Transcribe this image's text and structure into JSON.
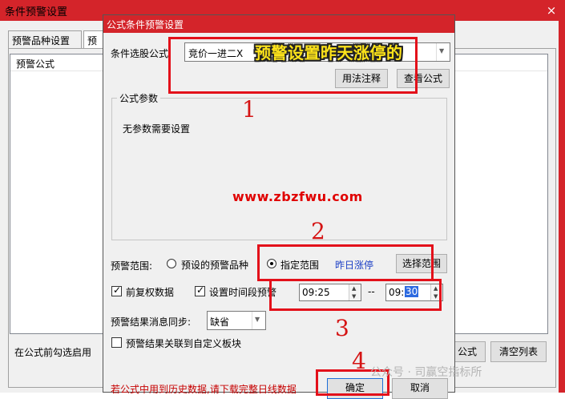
{
  "outer": {
    "title": "条件预警设置",
    "close_glyph": "×",
    "tabs": [
      "预警品种设置",
      "预"
    ],
    "list_header": "预警公式",
    "bottom_label": "在公式前勾选启用",
    "formula_button": "公式",
    "clear_button": "清空列表"
  },
  "dialog": {
    "title": "公式条件预警设置",
    "condition_label": "条件选股公式",
    "formula_value": "竞价一进二X",
    "overlay_caption": "预警设置昨天涨停的",
    "usage_button": "用法注释",
    "view_button": "查看公式",
    "params_legend": "公式参数",
    "params_empty": "无参数需要设置",
    "range_label": "预警范围:",
    "range_option_preset": "预设的预警品种",
    "range_option_specified": "指定范围",
    "range_selected": "specified",
    "range_value": "昨日涨停",
    "select_range_button": "选择范围",
    "adjusted_label": "前复权数据",
    "adjusted_checked": true,
    "timeslot_label": "设置时间段预警",
    "timeslot_checked": true,
    "time_start": "09:25",
    "time_separator": "--",
    "time_end_hour": "09:",
    "time_end_minute": "30",
    "sync_label": "预警结果消息同步:",
    "sync_value": "缺省",
    "custom_block_label": "预警结果关联到自定义板块",
    "custom_block_checked": false,
    "hint": "若公式中用到历史数据,请下载完整日线数据",
    "ok_button": "确定",
    "cancel_button": "取消"
  },
  "annotations": {
    "numbers": [
      "1",
      "2",
      "3",
      "4"
    ],
    "watermark_url": "www.zbzfwu.com",
    "wechat": "公众号 · 司赢空指标所"
  },
  "colors": {
    "titlebar": "#d4242a",
    "annotation_red": "#e3101a",
    "caption_yellow": "#fde31a",
    "link_blue": "#1a3ec5"
  },
  "icons": {
    "dropdown": "chevron-down-icon",
    "spinner": "spin-updown-icon",
    "close": "close-icon"
  }
}
